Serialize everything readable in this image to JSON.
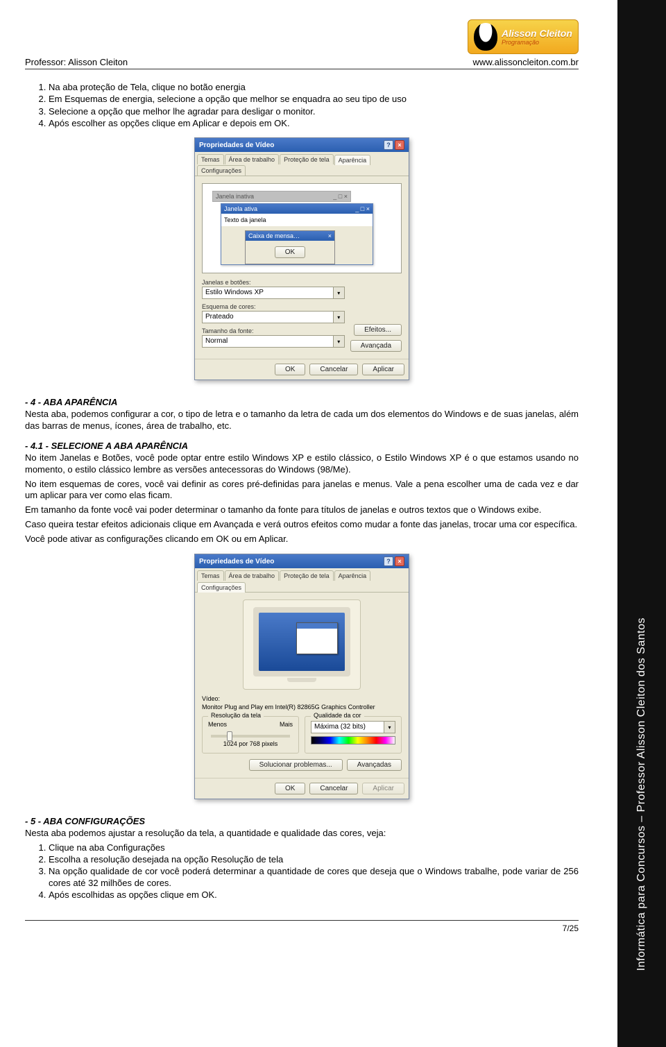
{
  "header": {
    "professor_label": "Professor: Alisson Cleiton",
    "site": "www.alissoncleiton.com.br",
    "logo_name": "Alisson Cleiton",
    "logo_sub": "Programação"
  },
  "stripe_text": "Informática para Concursos – Professor Alisson Cleiton dos Santos",
  "list1": [
    "Na aba proteção de Tela, clique no botão energia",
    "Em Esquemas de energia, selecione a opção que melhor se enquadra ao seu tipo de uso",
    "Selecione a opção que melhor lhe agradar para desligar o monitor.",
    "Após escolher as opções clique em Aplicar e depois em OK."
  ],
  "dlg1": {
    "title": "Propriedades de Vídeo",
    "tabs": [
      "Temas",
      "Área de trabalho",
      "Proteção de tela",
      "Aparência",
      "Configurações"
    ],
    "active_tab": "Aparência",
    "inactive_title": "Janela inativa",
    "active_title": "Janela ativa",
    "body_text": "Texto da janela",
    "msg_title": "Caixa de mensa…",
    "ok": "OK",
    "labels": {
      "janelas": "Janelas e botões:",
      "esquema": "Esquema de cores:",
      "fonte": "Tamanho da fonte:"
    },
    "values": {
      "janelas": "Estilo Windows XP",
      "esquema": "Prateado",
      "fonte": "Normal"
    },
    "side_btns": {
      "efeitos": "Efeitos...",
      "avancada": "Avançada"
    },
    "footer": {
      "ok": "OK",
      "cancelar": "Cancelar",
      "aplicar": "Aplicar"
    }
  },
  "sec4_title": "- 4 - ABA APARÊNCIA",
  "sec4_body": "Nesta aba, podemos configurar a cor, o tipo de letra e o tamanho da letra de cada um dos elementos do Windows e de suas janelas, além das barras de menus, ícones, área de trabalho, etc.",
  "sec41_title": "- 4.1 - SELECIONE A ABA APARÊNCIA",
  "sec41_p": [
    "No item Janelas e Botões, você pode optar entre estilo Windows XP e estilo clássico, o Estilo Windows XP é o que estamos usando no momento, o estilo clássico lembre as versões antecessoras do Windows (98/Me).",
    "No item esquemas de cores, você vai definir as cores pré-definidas para janelas e menus. Vale a pena escolher uma de cada vez e dar um aplicar para ver como elas ficam.",
    "Em tamanho da fonte você vai poder determinar o tamanho da fonte para títulos de janelas e outros textos que o Windows exibe.",
    "Caso queira testar efeitos adicionais clique em Avançada e verá outros efeitos como mudar a fonte das janelas, trocar uma cor específica.",
    "Você pode ativar as configurações clicando em OK ou em Aplicar."
  ],
  "dlg2": {
    "title": "Propriedades de Vídeo",
    "tabs": [
      "Temas",
      "Área de trabalho",
      "Proteção de tela",
      "Aparência",
      "Configurações"
    ],
    "active_tab": "Configurações",
    "video_label": "Vídeo:",
    "video_value": "Monitor Plug and Play em Intel(R) 82865G Graphics Controller",
    "res_legend": "Resolução da tela",
    "res_menos": "Menos",
    "res_mais": "Mais",
    "res_value": "1024 por 768 pixels",
    "qual_legend": "Qualidade da cor",
    "qual_value": "Máxima (32 bits)",
    "btn_solucionar": "Solucionar problemas...",
    "btn_avancadas": "Avançadas",
    "footer": {
      "ok": "OK",
      "cancelar": "Cancelar",
      "aplicar": "Aplicar"
    }
  },
  "sec5_title": "- 5  - ABA CONFIGURAÇÕES",
  "sec5_intro": "Nesta aba podemos ajustar a resolução da tela, a quantidade e qualidade das cores, veja:",
  "list2": [
    "Clique na aba Configurações",
    "Escolha a resolução desejada na opção Resolução de tela",
    "Na opção qualidade de cor você poderá determinar a quantidade de cores que deseja que o Windows trabalhe, pode variar de 256 cores até 32 milhões de cores.",
    "Após escolhidas as opções clique em OK."
  ],
  "page_footer": "7/25"
}
